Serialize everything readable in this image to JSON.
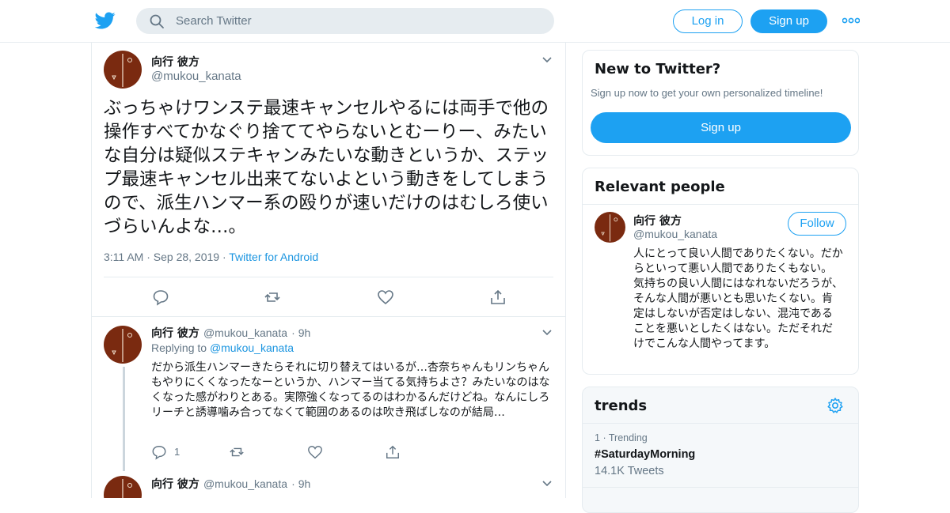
{
  "header": {
    "search_placeholder": "Search Twitter",
    "login_label": "Log in",
    "signup_label": "Sign up"
  },
  "main_tweet": {
    "name": "向行 彼方",
    "handle": "@mukou_kanata",
    "text": "ぶっちゃけワンステ最速キャンセルやるには両手で他の操作すべてかなぐり捨ててやらないとむーりー、みたいな自分は疑似ステキャンみたいな動きというか、ステップ最速キャンセル出来てないよという動きをしてしまうので、派生ハンマー系の殴りが速いだけのはむしろ使いづらいんよな…。",
    "time": "3:11 AM",
    "date": "Sep 28, 2019",
    "source": "Twitter for Android"
  },
  "replies": [
    {
      "name": "向行 彼方",
      "handle": "@mukou_kanata",
      "age": "9h",
      "replying_prefix": "Replying to",
      "replying_to": "@mukou_kanata",
      "text": "だから派生ハンマーきたらそれに切り替えてはいるが…杏奈ちゃんもリンちゃんもやりにくくなったなーというか、ハンマー当てる気持ちよさ？みたいなのはなくなった感がわりとある。実際強くなってるのはわかるんだけどね。なんにしろリーチと誘導噛み合ってなくて範囲のあるのは吹き飛ばしなのが結局…",
      "reply_count": "1"
    },
    {
      "name": "向行 彼方",
      "handle": "@mukou_kanata",
      "age": "9h"
    }
  ],
  "sidebar": {
    "new_to_twitter": {
      "title": "New to Twitter?",
      "subtitle": "Sign up now to get your own personalized timeline!",
      "signup_label": "Sign up"
    },
    "relevant_people": {
      "title": "Relevant people",
      "name": "向行 彼方",
      "handle": "@mukou_kanata",
      "follow_label": "Follow",
      "bio": "人にとって良い人間でありたくない。だからといって悪い人間でありたくもない。気持ちの良い人間にはなれないだろうが、そんな人間が悪いとも思いたくない。肯定はしないが否定はしない、混沌であることを悪いとしたくはない。ただそれだけでこんな人間やってます。"
    },
    "trends": {
      "title": "trends",
      "items": [
        {
          "rank": "1",
          "label": "Trending",
          "name": "#SaturdayMorning",
          "count": "14.1K Tweets"
        }
      ]
    }
  },
  "colors": {
    "brand": "#1da1f2",
    "link": "#1b95e0",
    "muted": "#657786",
    "border": "#e6ecf0"
  }
}
